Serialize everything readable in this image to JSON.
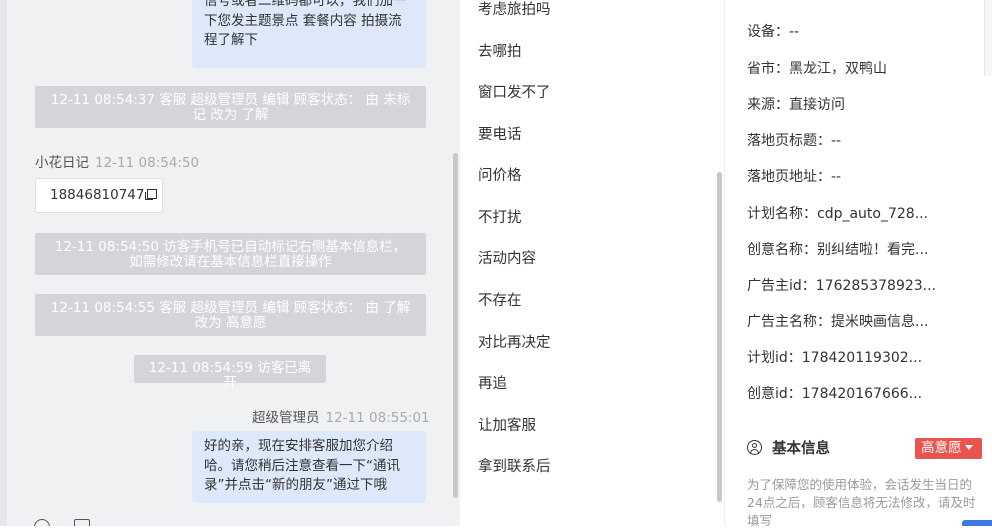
{
  "chat": {
    "messages": {
      "top_bubble": "信号或者二维码都可以，我们加一下您发主题景点 套餐内容 拍摄流程了解下",
      "sys1": "12-11 08:54:37 客服 超级管理员 编辑 顾客状态： 由 未标记 改为 了解",
      "visitor_name": "小花日记",
      "visitor_time": "12-11 08:54:50",
      "phone": "18846810747",
      "sys2": "12-11 08:54:50 访客手机号已自动标记右侧基本信息栏，如需修改请在基本信息栏直接操作",
      "sys3": "12-11 08:54:55 客服 超级管理员 编辑 顾客状态： 由 了解 改为 高意愿",
      "sys4": "12-11 08:54:59 访客已离开",
      "agent_name": "超级管理员",
      "agent_time": "12-11 08:55:01",
      "agent_bubble": "好的亲，现在安排客服加您介绍哈。请您稍后注意查看一下“通讯录”并点击“新的朋友”通过下哦"
    }
  },
  "quick_replies": [
    "考虑旅拍吗",
    "去哪拍",
    "窗口发不了",
    "要电话",
    "问价格",
    "不打扰",
    "活动内容",
    "不存在",
    "对比再决定",
    "再追",
    "让加客服",
    "拿到联系后"
  ],
  "info": {
    "rows": [
      "设备：--",
      "省市：黑龙江，双鸭山",
      "来源：直接访问",
      "落地页标题：--",
      "落地页地址：--",
      "计划名称：cdp_auto_728...",
      "创意名称：别纠结啦！看完...",
      "广告主id：176285378923...",
      "广告主名称：提米映画信息...",
      "计划id：178420119302...",
      "创意id：178420167666..."
    ],
    "section_title": "基本信息",
    "badge": "高意愿",
    "badge_color": "#e8554e",
    "note": "为了保障您的使用体验，会话发生当日的24点之后，顾客信息将无法修改，请及时填写"
  }
}
